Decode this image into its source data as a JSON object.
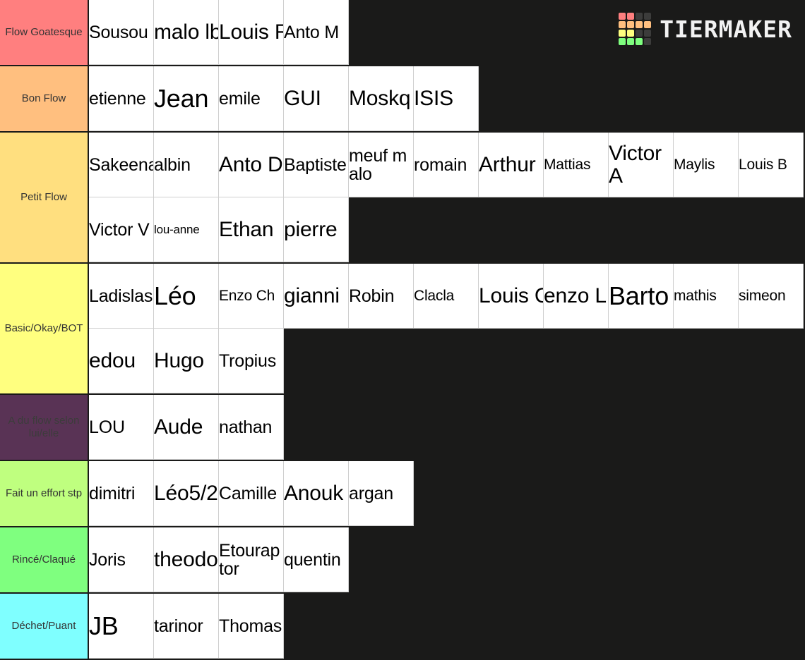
{
  "brand": {
    "name": "TIERMAKER",
    "logo_grid_colors": [
      "#ff7f7f",
      "#ff7f7f",
      "#3c3c3b",
      "#3c3c3b",
      "#ffbf7f",
      "#ffbf7f",
      "#ffbf7f",
      "#ffbf7f",
      "#ffff7f",
      "#ffff7f",
      "#3c3c3b",
      "#3c3c3b",
      "#7fff7f",
      "#7fff7f",
      "#7fff7f",
      "#3c3c3b"
    ],
    "background": "#1a1a19"
  },
  "tiers": [
    {
      "label": "Flow Goatesque",
      "color": "#ff7f7f",
      "items": [
        {
          "text": "Sousou",
          "size": "sz-m"
        },
        {
          "text": "malo lb",
          "size": "sz-l"
        },
        {
          "text": "Louis R",
          "size": "sz-l"
        },
        {
          "text": "Anto M",
          "size": "sz-m"
        }
      ]
    },
    {
      "label": "Bon Flow",
      "color": "#ffbf7f",
      "items": [
        {
          "text": "etienne",
          "size": "sz-m"
        },
        {
          "text": "Jean",
          "size": "sz-xl"
        },
        {
          "text": "emile",
          "size": "sz-m"
        },
        {
          "text": "GUI",
          "size": "sz-l"
        },
        {
          "text": "Moskq",
          "size": "sz-l"
        },
        {
          "text": "ISIS",
          "size": "sz-l"
        }
      ]
    },
    {
      "label": "Petit Flow",
      "color": "#ffdf7f",
      "items": [
        {
          "text": "Sakeena",
          "size": "sz-m"
        },
        {
          "text": "albin",
          "size": "sz-m"
        },
        {
          "text": "Anto D",
          "size": "sz-l"
        },
        {
          "text": "Baptiste",
          "size": "sz-m"
        },
        {
          "text": "meuf malo",
          "size": "sz-m",
          "two_line": true
        },
        {
          "text": "romain",
          "size": "sz-m"
        },
        {
          "text": "Arthur",
          "size": "sz-l"
        },
        {
          "text": "Mattias",
          "size": "sz-s"
        },
        {
          "text": "Victor A",
          "size": "sz-l",
          "two_line": true
        },
        {
          "text": "Maylis",
          "size": "sz-s"
        },
        {
          "text": "Louis B",
          "size": "sz-s"
        },
        {
          "text": "Victor V",
          "size": "sz-m"
        },
        {
          "text": "lou-anne",
          "size": "sz-xs"
        },
        {
          "text": "Ethan",
          "size": "sz-l"
        },
        {
          "text": "pierre",
          "size": "sz-l"
        }
      ]
    },
    {
      "label": "Basic/Okay/BOT",
      "color": "#ffff7f",
      "items": [
        {
          "text": "Ladislas",
          "size": "sz-m"
        },
        {
          "text": "Léo",
          "size": "sz-xl"
        },
        {
          "text": "Enzo Ch",
          "size": "sz-s"
        },
        {
          "text": "gianni",
          "size": "sz-l"
        },
        {
          "text": "Robin",
          "size": "sz-m"
        },
        {
          "text": "Clacla",
          "size": "sz-s"
        },
        {
          "text": "Louis C",
          "size": "sz-l"
        },
        {
          "text": "enzo L",
          "size": "sz-l"
        },
        {
          "text": "Barto",
          "size": "sz-xl"
        },
        {
          "text": "mathis",
          "size": "sz-s"
        },
        {
          "text": "simeon",
          "size": "sz-s"
        },
        {
          "text": "edou",
          "size": "sz-l"
        },
        {
          "text": "Hugo",
          "size": "sz-l"
        },
        {
          "text": "Tropius",
          "size": "sz-m"
        }
      ]
    },
    {
      "label": "A du flow selon lui/elle",
      "color": "#593355",
      "label_color": "#3c3c3b",
      "items": [
        {
          "text": "LOU",
          "size": "sz-m"
        },
        {
          "text": "Aude",
          "size": "sz-l"
        },
        {
          "text": "nathan",
          "size": "sz-m"
        }
      ]
    },
    {
      "label": "Fait un effort stp",
      "color": "#bfff7f",
      "items": [
        {
          "text": "dimitri",
          "size": "sz-m"
        },
        {
          "text": "Léo5/2",
          "size": "sz-l"
        },
        {
          "text": "Camille",
          "size": "sz-m"
        },
        {
          "text": "Anouk",
          "size": "sz-l"
        },
        {
          "text": "argan",
          "size": "sz-m"
        }
      ]
    },
    {
      "label": "Rincé/Claqué",
      "color": "#7fff7f",
      "items": [
        {
          "text": "Joris",
          "size": "sz-m"
        },
        {
          "text": "theodore",
          "size": "sz-l"
        },
        {
          "text": "Etouraptor",
          "size": "sz-m",
          "two_line": true
        },
        {
          "text": "quentin",
          "size": "sz-m"
        }
      ]
    },
    {
      "label": "Déchet/Puant",
      "color": "#7fffff",
      "items": [
        {
          "text": "JB",
          "size": "sz-xl"
        },
        {
          "text": "tarinor",
          "size": "sz-m"
        },
        {
          "text": "Thomas",
          "size": "sz-m"
        }
      ]
    }
  ]
}
